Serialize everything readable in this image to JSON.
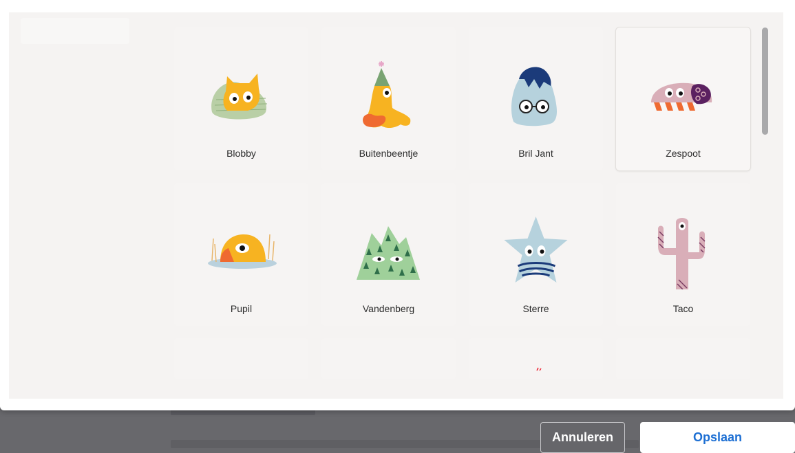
{
  "avatars": [
    {
      "name": "Blobby"
    },
    {
      "name": "Buitenbeentje"
    },
    {
      "name": "Bril Jant"
    },
    {
      "name": "Zespoot"
    },
    {
      "name": "Pupil"
    },
    {
      "name": "Vandenberg"
    },
    {
      "name": "Sterre"
    },
    {
      "name": "Taco"
    }
  ],
  "selected": "Zespoot",
  "footer": {
    "cancel_label": "Annuleren",
    "save_label": "Opslaan"
  },
  "colors": {
    "accent": "#1d6fd3",
    "panel": "#f5f3f2",
    "overlay": "#68686c"
  }
}
